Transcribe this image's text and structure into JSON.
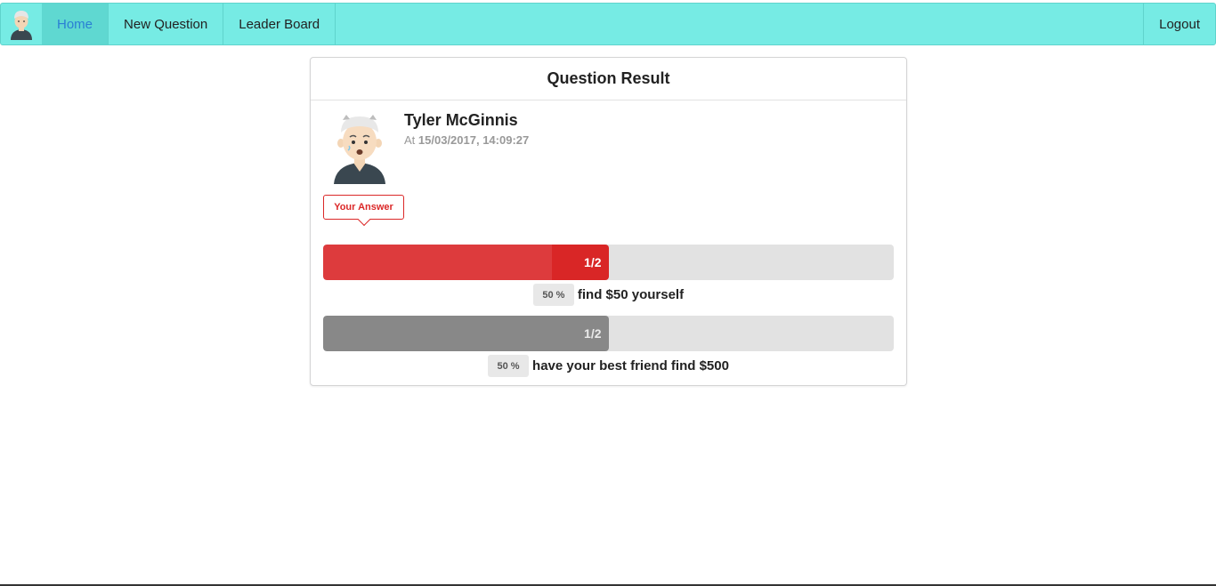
{
  "nav": {
    "items": [
      {
        "label": "Home",
        "active": true
      },
      {
        "label": "New Question",
        "active": false
      },
      {
        "label": "Leader Board",
        "active": false
      }
    ],
    "logout_label": "Logout",
    "accent_color": "#76ebe4"
  },
  "card": {
    "title": "Question Result",
    "author_name": "Tyler McGinnis",
    "date_prefix": "At ",
    "date_value": "15/03/2017, 14:09:27",
    "your_answer_label": "Your Answer",
    "options": [
      {
        "fraction_label": "1/2",
        "percent_label": "50 %",
        "text": "find $50 yourself",
        "fill_fraction": 0.5,
        "is_user_answer": true,
        "color": "#db2828"
      },
      {
        "fraction_label": "1/2",
        "percent_label": "50 %",
        "text": "have your best friend find $500",
        "fill_fraction": 0.5,
        "is_user_answer": false,
        "color": "#888888"
      }
    ]
  }
}
